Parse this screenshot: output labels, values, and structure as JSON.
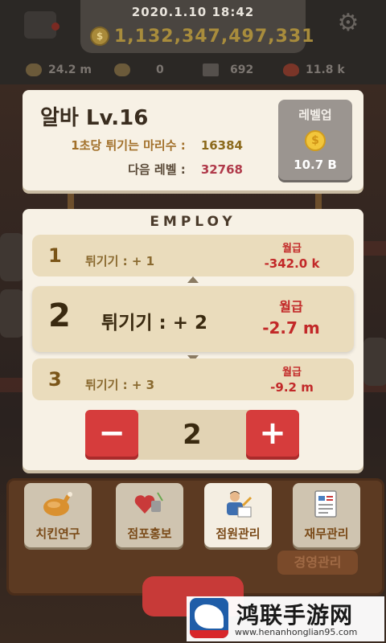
{
  "status_bar": {
    "datetime": "2020.1.10 18:42",
    "money": "1,132,347,497,331",
    "coin_symbol": "$",
    "stats": {
      "distance": "24.2 m",
      "zero": "0",
      "houses": "692",
      "likes": "11.8 k"
    }
  },
  "alba_card": {
    "title": "알바 Lv.16",
    "per_sec_label": "1초당 튀기는 마리수 :",
    "per_sec_value": "16384",
    "next_level_label": "다음 레벨 :",
    "next_level_value": "32768",
    "levelup": {
      "label": "레벨업",
      "coin_symbol": "$",
      "cost": "10.7 B"
    }
  },
  "employ": {
    "title": "EMPLOY",
    "rows": [
      {
        "num": "1",
        "label": "튀기기 : + 1",
        "salary_label": "월급",
        "salary_value": "-342.0 k"
      },
      {
        "num": "2",
        "label": "튀기기 : + 2",
        "salary_label": "월급",
        "salary_value": "-2.7 m"
      },
      {
        "num": "3",
        "label": "튀기기 : + 3",
        "salary_label": "월급",
        "salary_value": "-9.2 m"
      }
    ],
    "stepper": {
      "minus": "−",
      "value": "2",
      "plus": "+"
    }
  },
  "menu": [
    {
      "label": "치킨연구",
      "icon": "roast-chicken-icon"
    },
    {
      "label": "점포홍보",
      "icon": "heart-megaphone-icon"
    },
    {
      "label": "점원관리",
      "icon": "clerk-icon"
    },
    {
      "label": "재무관리",
      "icon": "finance-report-icon"
    }
  ],
  "background": {
    "management_label": "경영관리"
  },
  "watermark": {
    "title": "鸿联手游网",
    "url": "www.henanhonglian95.com"
  },
  "colors": {
    "card_bg": "#f7f1e5",
    "row_bg": "#eadcbc",
    "accent_red": "#d63c3c",
    "salary_red": "#c22828",
    "levelup_gray": "#9b9590",
    "coin_gold": "#f2c63b"
  }
}
